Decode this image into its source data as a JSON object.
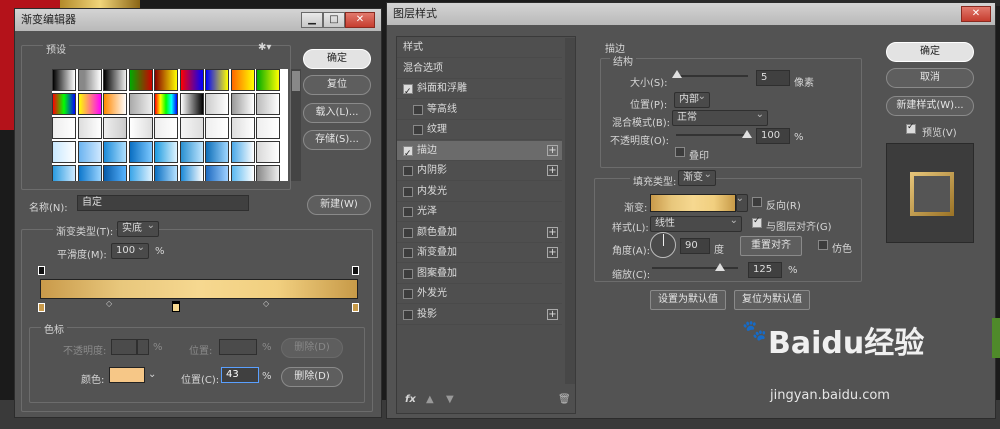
{
  "gradient_editor": {
    "title": "渐变编辑器",
    "presets_label": "预设",
    "buttons": {
      "ok": "确定",
      "reset": "复位",
      "load": "载入(L)...",
      "save": "存储(S)...",
      "new": "新建(W)"
    },
    "name_label": "名称(N):",
    "name_value": "自定",
    "gradient_type_label": "渐变类型(T):",
    "gradient_type_value": "实底",
    "smoothness_label": "平滑度(M):",
    "smoothness_value": "100",
    "smoothness_unit": "%",
    "stops_group_label": "色标",
    "opacity_label": "不透明度:",
    "opacity_unit": "%",
    "location_label_dim": "位置:",
    "location_unit_dim": "%",
    "delete_dim": "删除(D)",
    "color_label": "颜色:",
    "color_value": "#f6c787",
    "location_label": "位置(C):",
    "location_value": "43",
    "location_unit": "%",
    "delete_label": "删除(D)",
    "gradient_colors": [
      "#c99a4a",
      "#e8c77c",
      "#f6d890",
      "#f1cf7f",
      "#c79a48"
    ]
  },
  "layer_style": {
    "title": "图层样式",
    "style_list": [
      {
        "label": "样式",
        "checkbox": false,
        "checked": false,
        "plus": false,
        "active": false
      },
      {
        "label": "混合选项",
        "checkbox": false,
        "checked": false,
        "plus": false,
        "active": false
      },
      {
        "label": "斜面和浮雕",
        "checkbox": true,
        "checked": true,
        "plus": false,
        "active": false
      },
      {
        "label": "等高线",
        "checkbox": true,
        "checked": false,
        "plus": false,
        "active": false,
        "indent": true
      },
      {
        "label": "纹理",
        "checkbox": true,
        "checked": false,
        "plus": false,
        "active": false,
        "indent": true
      },
      {
        "label": "描边",
        "checkbox": true,
        "checked": true,
        "plus": true,
        "active": true
      },
      {
        "label": "内阴影",
        "checkbox": true,
        "checked": false,
        "plus": true,
        "active": false
      },
      {
        "label": "内发光",
        "checkbox": true,
        "checked": false,
        "plus": false,
        "active": false
      },
      {
        "label": "光泽",
        "checkbox": true,
        "checked": false,
        "plus": false,
        "active": false
      },
      {
        "label": "颜色叠加",
        "checkbox": true,
        "checked": false,
        "plus": true,
        "active": false
      },
      {
        "label": "渐变叠加",
        "checkbox": true,
        "checked": false,
        "plus": true,
        "active": false
      },
      {
        "label": "图案叠加",
        "checkbox": true,
        "checked": false,
        "plus": false,
        "active": false
      },
      {
        "label": "外发光",
        "checkbox": true,
        "checked": false,
        "plus": false,
        "active": false
      },
      {
        "label": "投影",
        "checkbox": true,
        "checked": false,
        "plus": true,
        "active": false
      }
    ],
    "footer_fx": "fx",
    "stroke_section": "描边",
    "structure_label": "结构",
    "size_label": "大小(S):",
    "size_value": "5",
    "size_unit": "像素",
    "position_label": "位置(P):",
    "position_value": "内部",
    "blend_label": "混合模式(B):",
    "blend_value": "正常",
    "opacity_label": "不透明度(O):",
    "opacity_value": "100",
    "opacity_unit": "%",
    "overprint_label": "叠印",
    "fill_type_label": "填充类型:",
    "fill_type_value": "渐变",
    "gradient_label": "渐变:",
    "reverse_label": "反向(R)",
    "style_label": "样式(L):",
    "style_value": "线性",
    "align_label": "与图层对齐(G)",
    "angle_label": "角度(A):",
    "angle_value": "90",
    "angle_unit": "度",
    "reset_align": "重置对齐",
    "dither_label": "仿色",
    "scale_label": "缩放(C):",
    "scale_value": "125",
    "scale_unit": "%",
    "make_default": "设置为默认值",
    "reset_default": "复位为默认值",
    "buttons": {
      "ok": "确定",
      "cancel": "取消",
      "new_style": "新建样式(W)...",
      "preview": "预览(V)"
    }
  },
  "watermark": {
    "brand": "Baidu经验",
    "url": "jingyan.baidu.com"
  }
}
